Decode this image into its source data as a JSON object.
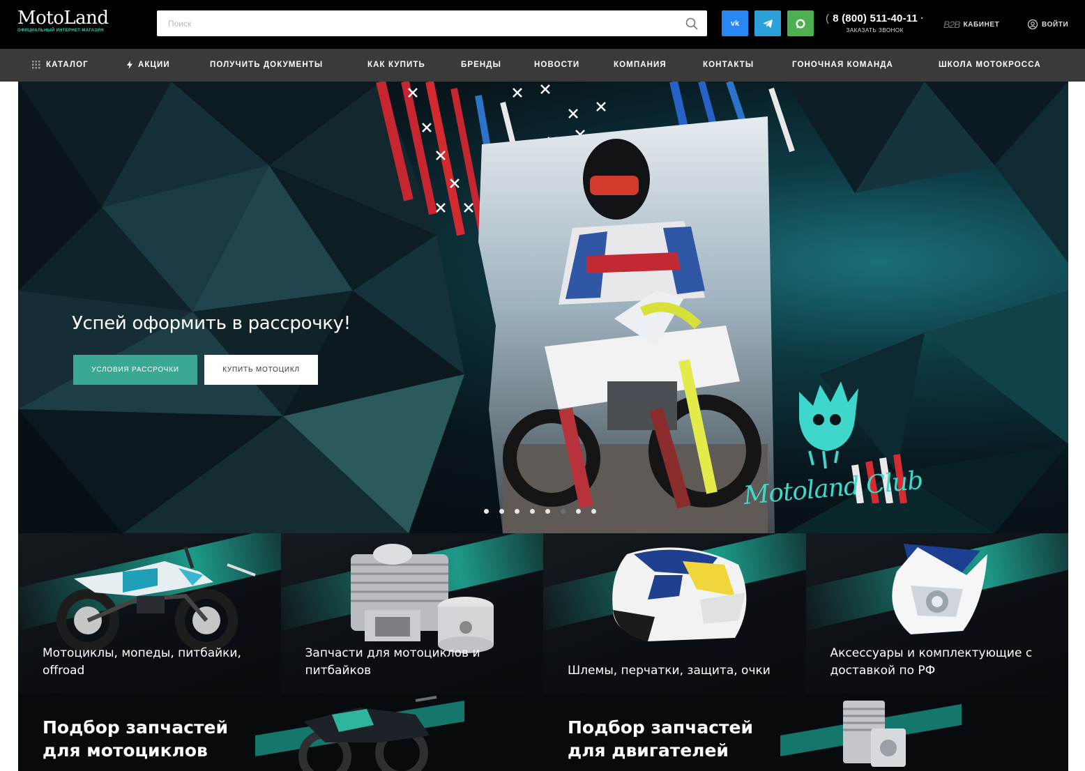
{
  "header": {
    "logo_main": "MotoLand",
    "logo_sub": "ОФИЦИАЛЬНЫЙ ИНТЕРНЕТ-МАГАЗИН",
    "search_placeholder": "Поиск",
    "social": [
      {
        "name": "vk",
        "label": "vk",
        "color": "#2787f5"
      },
      {
        "name": "telegram",
        "label": "",
        "color": "#2ba0d9"
      },
      {
        "name": "whatsapp",
        "label": "",
        "color": "#4caf50"
      }
    ],
    "phone": "8 (800) 511-40-11",
    "call_label": "ЗАКАЗАТЬ ЗВОНОК",
    "b2b_label": "B2B",
    "cabinet_label": "КАБИНЕТ",
    "login_label": "ВОЙТИ"
  },
  "nav": {
    "items": [
      "КАТАЛОГ",
      "АКЦИИ",
      "ПОЛУЧИТЬ ДОКУМЕНТЫ",
      "КАК КУПИТЬ",
      "БРЕНДЫ",
      "НОВОСТИ",
      "КОМПАНИЯ",
      "КОНТАКТЫ",
      "ГОНОЧНАЯ КОМАНДА",
      "ШКОЛА МОТОКРОССА"
    ]
  },
  "hero": {
    "title": "Успей оформить в рассрочку!",
    "primary_button": "УСЛОВИЯ РАССРОЧКИ",
    "secondary_button": "КУПИТЬ МОТОЦИКЛ",
    "club_text": "Motoland Club",
    "slides_total": 8,
    "active_slide": 6,
    "accent_color": "#3aa892"
  },
  "categories": [
    {
      "label": "Мотоциклы, мопеды, питбайки, offroad",
      "icon": "pitbike-image"
    },
    {
      "label": "Запчасти для мотоциклов и питбайков",
      "icon": "cylinder-piston-image"
    },
    {
      "label": "Шлемы, перчатки, защита, очки",
      "icon": "helmet-image"
    },
    {
      "label": "Аксессуары и комплектующие с доставкой по РФ",
      "icon": "headlight-mask-image"
    }
  ],
  "promos": [
    {
      "line1": "Подбор запчастей",
      "line2": "для мотоциклов",
      "icon": "motorcycle-image"
    },
    {
      "line1": "Подбор запчастей",
      "line2": "для двигателей",
      "icon": "engine-image"
    }
  ]
}
